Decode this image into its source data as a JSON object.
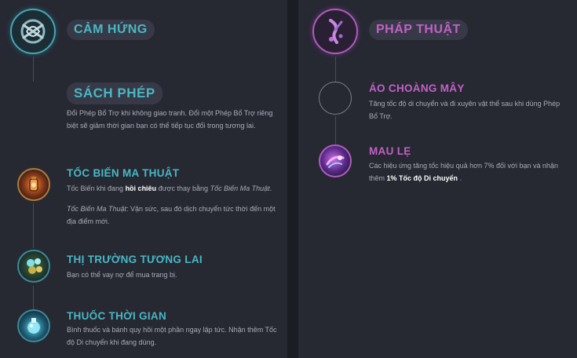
{
  "colors": {
    "background": "#1e2029",
    "panel": "#262832",
    "teal_accent": "#48b8c4",
    "purple_accent": "#c260c8",
    "body_text": "#a9acb6"
  },
  "left_tree": {
    "icon": "inspiration-tree-icon",
    "title": "CẢM HỨNG",
    "keystone": {
      "title": "SÁCH PHÉP",
      "desc": "Đổi Phép Bổ Trợ khi không giao tranh. Đổi một Phép Bổ Trợ riêng biệt sẽ giảm thời gian bạn có thể tiếp tục đổi trong tương lai."
    },
    "runes": [
      {
        "icon": "lantern-icon",
        "title": "TỐC BIẾN MA THUẬT",
        "desc1_a": "Tốc Biến khi đang",
        "desc1_bold": "hồi chiêu",
        "desc1_b": "được thay bằng",
        "desc1_italic": "Tốc Biến Ma Thuật",
        "desc1_end": ".",
        "desc2_italic": "Tốc Biến Ma Thuật",
        "desc2_rest": ": Vận sức, sau đó dịch chuyển tức thời đến một địa điểm mới."
      },
      {
        "icon": "coins-icon",
        "title": "THỊ TRƯỜNG TƯƠNG LAI",
        "desc": "Bạn có thể vay nợ để mua trang bị."
      },
      {
        "icon": "potion-icon",
        "title": "THUỐC THỜI GIAN",
        "desc": "Bình thuốc và bánh quy hồi một phần ngay lập tức. Nhận thêm Tốc độ Di chuyển khi đang dùng."
      }
    ]
  },
  "right_tree": {
    "icon": "sorcery-tree-icon",
    "title": "PHÁP THUẬT",
    "runes": [
      {
        "icon": "empty-slot-icon",
        "title": "ÁO CHOÀNG MÂY",
        "desc": "Tăng tốc độ di chuyển và đi xuyên vật thể sau khi dùng Phép Bổ Trợ."
      },
      {
        "icon": "celerity-icon",
        "title": "MAU LẸ",
        "desc_a": "Các hiệu ứng tăng tốc hiệu quả hơn 7% đối với bạn và nhận thêm",
        "desc_bold": "1% Tốc độ Di chuyển",
        "desc_end": "."
      }
    ]
  }
}
